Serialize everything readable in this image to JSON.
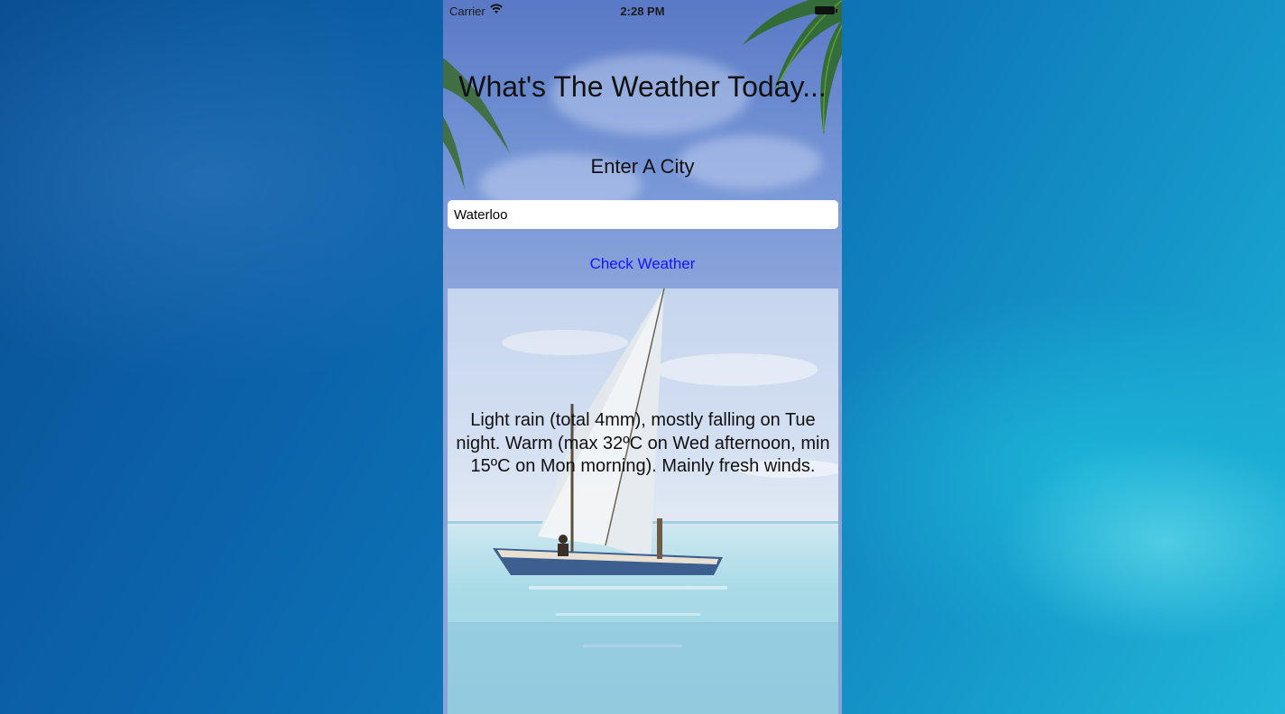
{
  "status_bar": {
    "carrier": "Carrier",
    "time": "2:28 PM",
    "wifi_icon": "wifi-icon",
    "battery_icon": "battery-icon"
  },
  "app": {
    "title": "What's The Weather Today...",
    "prompt": "Enter A City",
    "city_input": {
      "value": "Waterloo",
      "placeholder": ""
    },
    "check_button_label": "Check Weather",
    "forecast": "Light rain (total 4mm), mostly falling on Tue night. Warm (max 32ºC on Wed afternoon, min 15ºC on Mon morning). Mainly fresh winds.",
    "colors": {
      "button_text": "#1414ff",
      "background_sky": "#6f8fd2",
      "desktop_ocean": "#0b63aa"
    }
  }
}
